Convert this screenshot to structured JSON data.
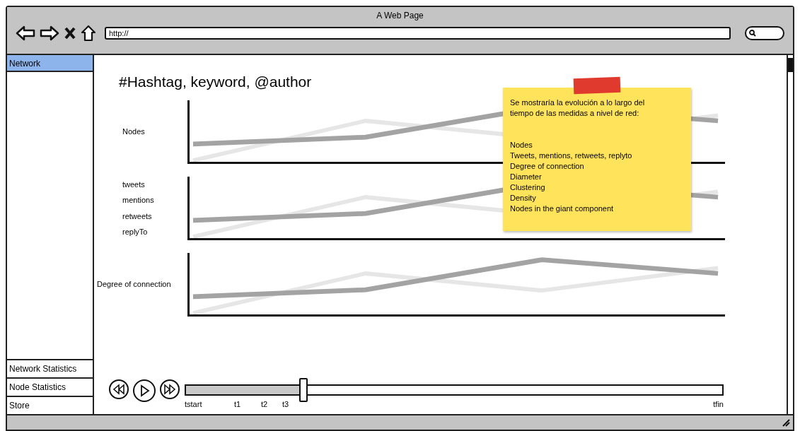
{
  "window": {
    "title": "A Web Page"
  },
  "browser": {
    "url": "http://"
  },
  "sidebar": {
    "items": [
      {
        "label": "Network",
        "selected": true
      }
    ],
    "bottom_items": [
      {
        "label": "Network Statistics",
        "selected": false
      },
      {
        "label": "Node Statistics",
        "selected": false
      },
      {
        "label": "Store",
        "selected": false
      }
    ]
  },
  "heading": "#Hashtag, keyword, @author",
  "charts": [
    {
      "labels": [
        "Nodes"
      ]
    },
    {
      "labels": [
        "tweets",
        "mentions",
        "retweets",
        "replyTo"
      ]
    },
    {
      "labels": [
        "Degree of connection"
      ]
    }
  ],
  "note": {
    "intro": "Se mostraría la evolución a lo largo del tiempo de las medidas a nivel de red:",
    "items": [
      "Nodes",
      "Tweets, mentions, retweets, replyto",
      "Degree of connection",
      "Diameter",
      "Clustering",
      "Density",
      "Nodes in the giant component"
    ]
  },
  "timeline": {
    "level": 0.22,
    "ticks": [
      "tstart",
      "t1",
      "t2",
      "t3"
    ],
    "end_tick": "tfin"
  }
}
